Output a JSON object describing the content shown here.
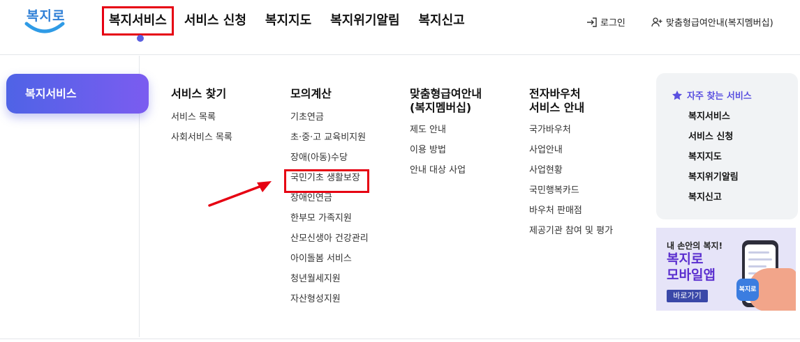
{
  "header": {
    "logo_text": "복지로",
    "gnb": [
      "복지서비스",
      "서비스 신청",
      "복지지도",
      "복지위기알림",
      "복지신고"
    ],
    "login_label": "로그인",
    "member_label": "맞춤형급여안내(복지멤버십)"
  },
  "side": {
    "active_label": "복지서비스"
  },
  "columns": [
    {
      "title": "서비스 찾기",
      "items": [
        "서비스 목록",
        "사회서비스 목록"
      ]
    },
    {
      "title": "모의계산",
      "items": [
        "기초연금",
        "초·중·고 교육비지원",
        "장애(아동)수당",
        "국민기초 생활보장",
        "장애인연금",
        "한부모 가족지원",
        "산모신생아 건강관리",
        "아이돌봄 서비스",
        "청년월세지원",
        "자산형성지원"
      ]
    },
    {
      "title": "맞춤형급여안내\n(복지멤버십)",
      "items": [
        "제도 안내",
        "이용 방법",
        "안내 대상 사업"
      ]
    },
    {
      "title": "전자바우처\n서비스 안내",
      "items": [
        "국가바우처",
        "사업안내",
        "사업현황",
        "국민행복카드",
        "바우처 판매점",
        "제공기관 참여 및 평가"
      ]
    }
  ],
  "favorites": {
    "title": "자주 찾는 서비스",
    "items": [
      "복지서비스",
      "서비스 신청",
      "복지지도",
      "복지위기알림",
      "복지신고"
    ]
  },
  "banner": {
    "sub": "내 손안의 복지!",
    "main": "복지로\n모바일앱",
    "button": "바로가기",
    "icon_text": "복지로"
  },
  "colors": {
    "accent": "#5a5fe0",
    "highlight": "#e60012",
    "brand_blue": "#2f7fd6"
  },
  "icons": [
    "login-icon",
    "user-plus-icon",
    "star-icon",
    "arrow-icon"
  ]
}
